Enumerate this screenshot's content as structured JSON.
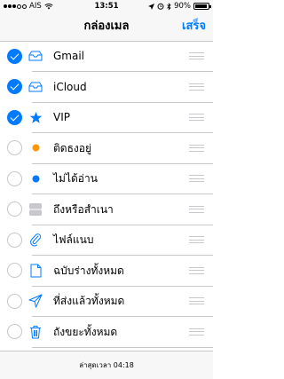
{
  "status_bar": {
    "carrier": "AIS",
    "time": "13:51",
    "battery": "90%",
    "battery_level": 0.9
  },
  "nav": {
    "title": "กล่องเมล",
    "done_label": "เสร็จ"
  },
  "colors": {
    "accent": "#007aff",
    "orange_dot": "#ff9500",
    "blue_dot": "#007aff"
  },
  "mailboxes": [
    {
      "label": "Gmail",
      "checked": true,
      "icon": "inbox-tray-icon"
    },
    {
      "label": "iCloud",
      "checked": true,
      "icon": "inbox-tray-icon"
    },
    {
      "label": "VIP",
      "checked": true,
      "icon": "star-icon"
    },
    {
      "label": "ติดธงอยู่",
      "checked": false,
      "icon": "orange-dot-icon"
    },
    {
      "label": "ไม่ได้อ่าน",
      "checked": false,
      "icon": "blue-dot-icon"
    },
    {
      "label": "ถึงหรือสำเนา",
      "checked": false,
      "icon": "to-cc-icon"
    },
    {
      "label": "ไฟล์แนบ",
      "checked": false,
      "icon": "paperclip-icon"
    },
    {
      "label": "ฉบับร่างทั้งหมด",
      "checked": false,
      "icon": "document-icon"
    },
    {
      "label": "ที่ส่งแล้วทั้งหมด",
      "checked": false,
      "icon": "paper-plane-icon"
    },
    {
      "label": "ถังขยะทั้งหมด",
      "checked": false,
      "icon": "trash-icon"
    }
  ],
  "footer": {
    "updated_text": "ล่าสุดเวลา 04:18"
  }
}
